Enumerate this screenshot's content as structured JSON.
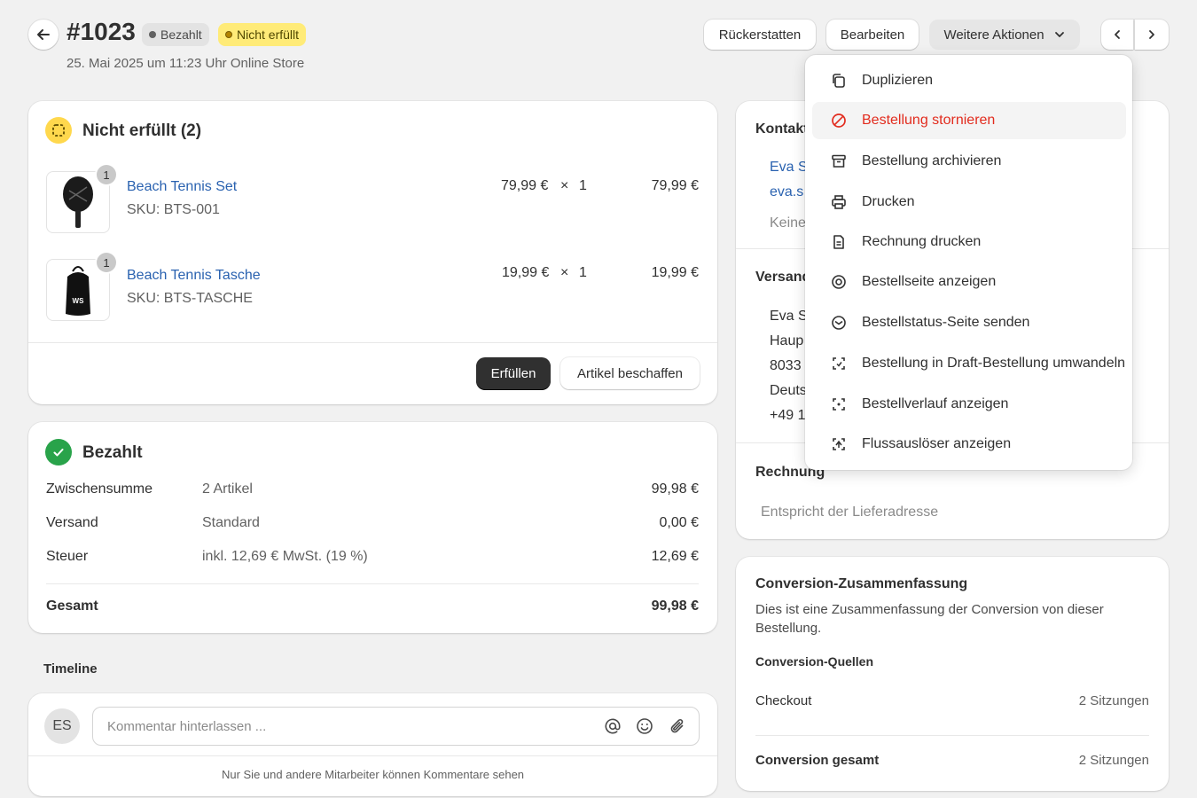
{
  "header": {
    "order_number": "#1023",
    "badge_paid": "Bezahlt",
    "badge_unfulfilled": "Nicht erfüllt",
    "subtitle": "25. Mai 2025 um 11:23 Uhr Online Store",
    "refund_label": "Rückerstatten",
    "edit_label": "Bearbeiten",
    "more_actions_label": "Weitere Aktionen"
  },
  "dropdown": {
    "items": [
      {
        "label": "Duplizieren",
        "icon": "duplicate-icon"
      },
      {
        "label": "Bestellung stornieren",
        "icon": "cancel-icon"
      },
      {
        "label": "Bestellung archivieren",
        "icon": "archive-icon"
      },
      {
        "label": "Drucken",
        "icon": "print-icon"
      },
      {
        "label": "Rechnung drucken",
        "icon": "invoice-icon"
      },
      {
        "label": "Bestellseite anzeigen",
        "icon": "view-icon"
      },
      {
        "label": "Bestellstatus-Seite senden",
        "icon": "mail-icon"
      },
      {
        "label": "Bestellung in Draft-Bestellung umwandeln",
        "icon": "convert-icon"
      },
      {
        "label": "Bestellverlauf anzeigen",
        "icon": "history-icon"
      },
      {
        "label": "Flussauslöser anzeigen",
        "icon": "flow-icon"
      }
    ]
  },
  "fulfillment": {
    "title": "Nicht erfüllt (2)",
    "items": [
      {
        "name": "Beach Tennis Set",
        "sku": "SKU: BTS-001",
        "price": "79,99 €",
        "times": "×",
        "qty": "1",
        "total": "79,99 €",
        "badge": "1"
      },
      {
        "name": "Beach Tennis Tasche",
        "sku": "SKU: BTS-TASCHE",
        "price": "19,99 €",
        "times": "×",
        "qty": "1",
        "total": "19,99 €",
        "badge": "1"
      }
    ],
    "fulfill_label": "Erfüllen",
    "source_label": "Artikel beschaffen"
  },
  "payment": {
    "title": "Bezahlt",
    "rows": [
      {
        "label": "Zwischensumme",
        "detail": "2 Artikel",
        "value": "99,98 €"
      },
      {
        "label": "Versand",
        "detail": "Standard",
        "value": "0,00 €"
      },
      {
        "label": "Steuer",
        "detail": "inkl. 12,69 € MwSt. (19 %)",
        "value": "12,69 €"
      }
    ],
    "total_label": "Gesamt",
    "total_value": "99,98 €"
  },
  "timeline": {
    "title": "Timeline",
    "avatar": "ES",
    "comment_placeholder": "Kommentar hinterlassen ...",
    "note": "Nur Sie und andere Mitarbeiter können Kommentare sehen"
  },
  "sidebar": {
    "contact_title": "Kontakt",
    "contact_name": "Eva S",
    "contact_email": "eva.s",
    "contact_none": "Keine",
    "shipping_title": "Versand",
    "shipping_lines": [
      "Eva S",
      "Haup",
      "8033",
      "Deuts",
      "+49 1"
    ],
    "billing_title": "Rechnung",
    "billing_text": "Entspricht der Lieferadresse",
    "conversion_title": "Conversion-Zusammenfassung",
    "conversion_desc": "Dies ist eine Zusammenfassung der Conversion von dieser Bestellung.",
    "sources_title": "Conversion-Quellen",
    "checkout_label": "Checkout",
    "checkout_value": "2 Sitzungen",
    "total_label": "Conversion gesamt",
    "total_value": "2 Sitzungen"
  },
  "colors": {
    "danger": "#e22c1e",
    "link": "#2a62b0",
    "badge_yellow": "#ffeb78",
    "success": "#29a34a",
    "primary_button": "#303030"
  }
}
